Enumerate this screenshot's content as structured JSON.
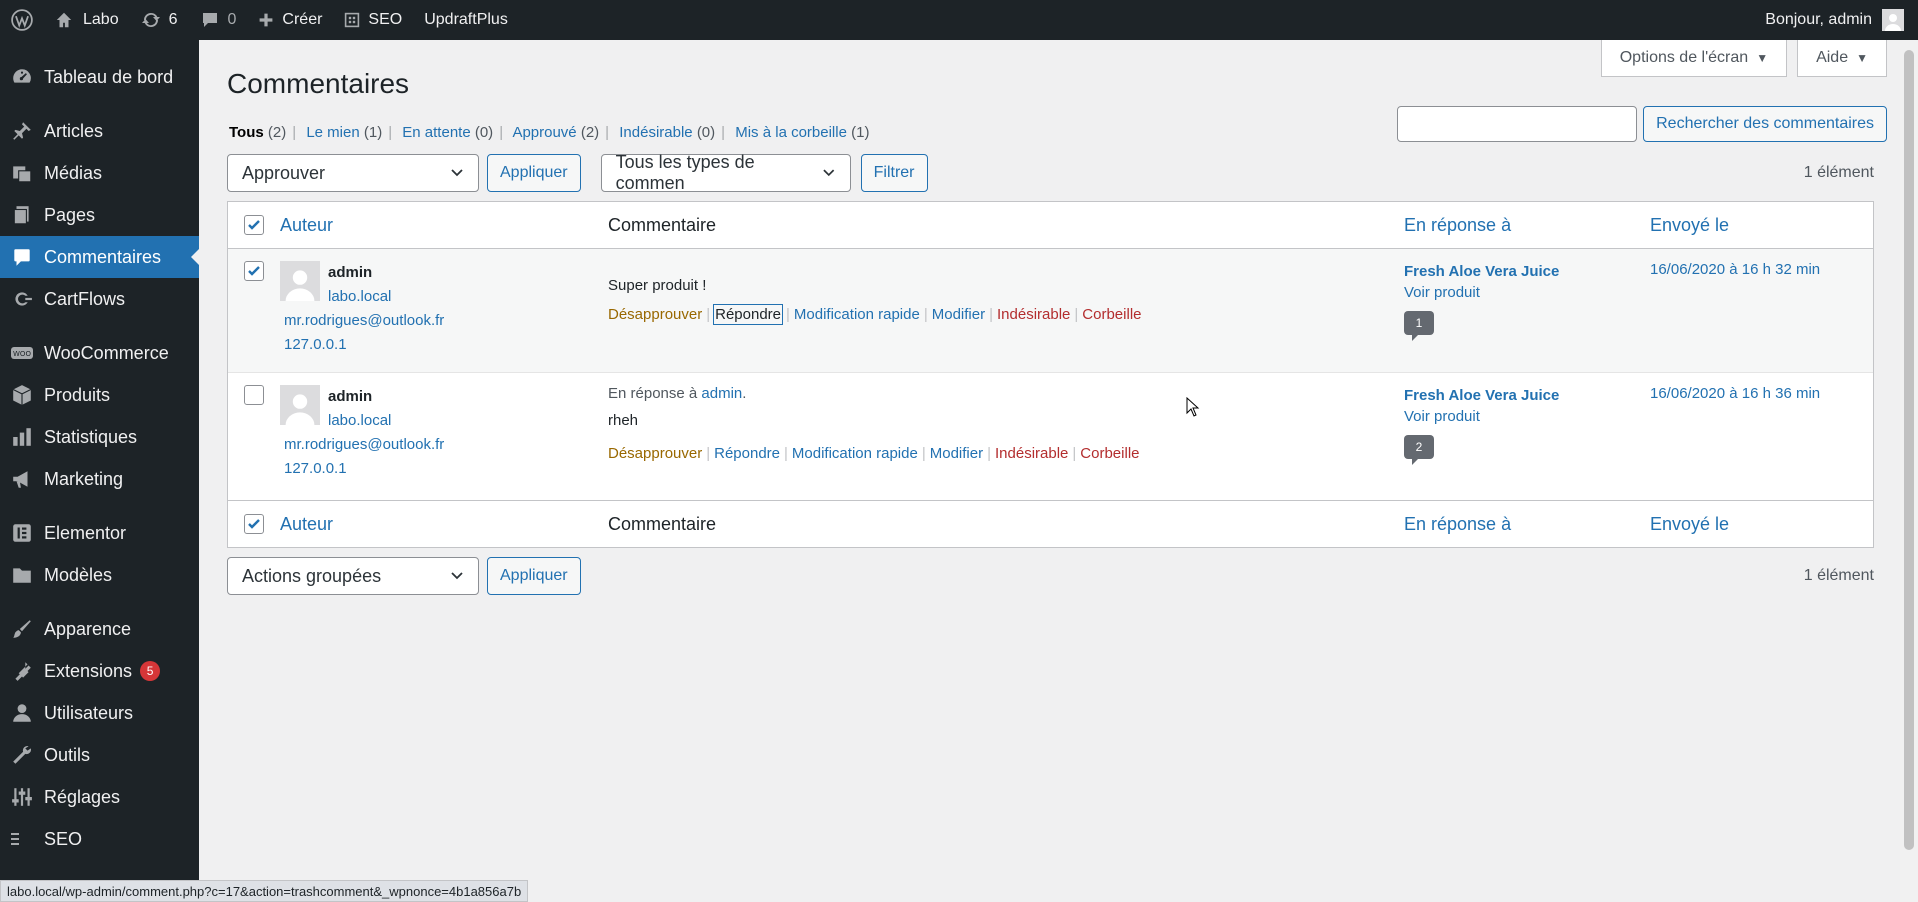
{
  "adminbar": {
    "site": "Labo",
    "updates_count": "6",
    "comments_count": "0",
    "new_label": "Créer",
    "seo_label": "SEO",
    "updraft_label": "UpdraftPlus",
    "greeting": "Bonjour, admin"
  },
  "sidebar": {
    "items": [
      {
        "label": "Tableau de bord",
        "icon": "dashboard-icon"
      },
      {
        "label": "Articles",
        "icon": "pin-icon"
      },
      {
        "label": "Médias",
        "icon": "media-icon"
      },
      {
        "label": "Pages",
        "icon": "pages-icon"
      },
      {
        "label": "Commentaires",
        "icon": "comment-icon"
      },
      {
        "label": "CartFlows",
        "icon": "cartflows-icon"
      },
      {
        "label": "WooCommerce",
        "icon": "woo-icon"
      },
      {
        "label": "Produits",
        "icon": "box-icon"
      },
      {
        "label": "Statistiques",
        "icon": "chart-icon"
      },
      {
        "label": "Marketing",
        "icon": "megaphone-icon"
      },
      {
        "label": "Elementor",
        "icon": "elementor-icon"
      },
      {
        "label": "Modèles",
        "icon": "folder-icon"
      },
      {
        "label": "Apparence",
        "icon": "brush-icon"
      },
      {
        "label": "Extensions",
        "icon": "plugin-icon",
        "badge": "5"
      },
      {
        "label": "Utilisateurs",
        "icon": "user-icon"
      },
      {
        "label": "Outils",
        "icon": "wrench-icon"
      },
      {
        "label": "Réglages",
        "icon": "settings-icon"
      },
      {
        "label": "SEO",
        "icon": "seo-icon"
      }
    ]
  },
  "screen_options": "Options de l'écran",
  "help": "Aide",
  "page_title": "Commentaires",
  "filters": [
    {
      "label": "Tous",
      "count": "(2)",
      "current": true
    },
    {
      "label": "Le mien",
      "count": "(1)"
    },
    {
      "label": "En attente",
      "count": "(0)"
    },
    {
      "label": "Approuvé",
      "count": "(2)"
    },
    {
      "label": "Indésirable",
      "count": "(0)"
    },
    {
      "label": "Mis à la corbeille",
      "count": "(1)"
    }
  ],
  "search": {
    "value": "",
    "button": "Rechercher des commentaires"
  },
  "top_nav": {
    "bulk_select": "Approuver",
    "apply": "Appliquer",
    "type_select": "Tous les types de commen",
    "filter": "Filtrer",
    "count": "1 élément"
  },
  "bottom_nav": {
    "bulk_select": "Actions groupées",
    "apply": "Appliquer",
    "count": "1 élément"
  },
  "columns": {
    "author": "Auteur",
    "comment": "Commentaire",
    "response": "En réponse à",
    "date": "Envoyé le"
  },
  "rows": [
    {
      "checked": true,
      "author": "admin",
      "site": "labo.local",
      "email": "mr.rodrigues@outlook.fr",
      "ip": "127.0.0.1",
      "in_reply_prefix": "",
      "in_reply_name": "",
      "text": "Super produit !",
      "actions": {
        "unapprove": "Désapprouver",
        "reply": "Répondre",
        "quickedit": "Modification rapide",
        "edit": "Modifier",
        "spam": "Indésirable",
        "trash": "Corbeille"
      },
      "post_title": "Fresh Aloe Vera Juice",
      "view_product": "Voir produit",
      "bubble": "1",
      "date": "16/06/2020 à 16 h 32 min"
    },
    {
      "checked": false,
      "author": "admin",
      "site": "labo.local",
      "email": "mr.rodrigues@outlook.fr",
      "ip": "127.0.0.1",
      "in_reply_prefix": "En réponse à",
      "in_reply_name": "admin",
      "text": "rheh",
      "actions": {
        "unapprove": "Désapprouver",
        "reply": "Répondre",
        "quickedit": "Modification rapide",
        "edit": "Modifier",
        "spam": "Indésirable",
        "trash": "Corbeille"
      },
      "post_title": "Fresh Aloe Vera Juice",
      "view_product": "Voir produit",
      "bubble": "2",
      "date": "16/06/2020 à 16 h 36 min"
    }
  ],
  "status_url": "labo.local/wp-admin/comment.php?c=17&action=trashcomment&_wpnonce=4b1a856a7b",
  "colors": {
    "accent": "#2271b1",
    "sidebar": "#1d2327",
    "danger": "#b32d2e",
    "warning": "#996800"
  }
}
